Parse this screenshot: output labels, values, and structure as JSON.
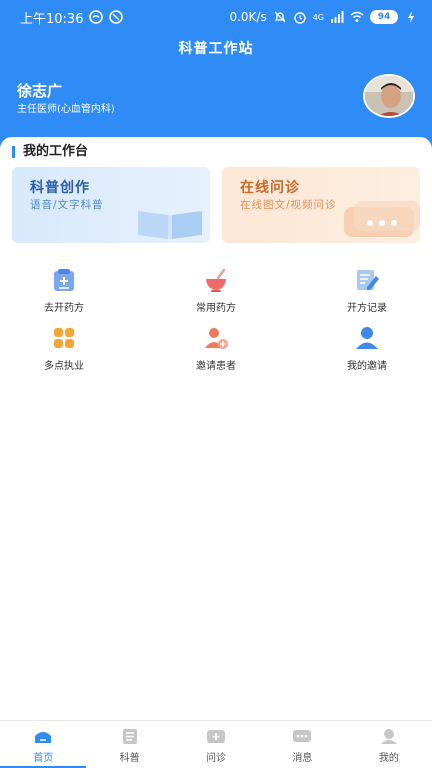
{
  "status_bar": {
    "time": "上午10:36",
    "speed": "0.0K/s",
    "network": "4G",
    "battery": "94"
  },
  "header": {
    "title": "科普工作站",
    "doctor_name": "徐志广",
    "doctor_title": "主任医师(心血管内科)"
  },
  "workbench": {
    "title": "我的工作台",
    "cards": [
      {
        "title": "科普创作",
        "subtitle": "语音/文字科普"
      },
      {
        "title": "在线问诊",
        "subtitle": "在线图文/视频问诊"
      }
    ],
    "grid": [
      {
        "label": "去开药方",
        "icon": "prescription-icon"
      },
      {
        "label": "常用药方",
        "icon": "medicine-bowl-icon"
      },
      {
        "label": "开方记录",
        "icon": "record-edit-icon"
      },
      {
        "label": "多点执业",
        "icon": "multi-grid-icon"
      },
      {
        "label": "邀请患者",
        "icon": "invite-patient-icon"
      },
      {
        "label": "我的邀请",
        "icon": "my-invite-icon"
      }
    ]
  },
  "tabbar": {
    "tabs": [
      {
        "label": "首页",
        "icon": "home-icon",
        "active": true
      },
      {
        "label": "科普",
        "icon": "article-icon"
      },
      {
        "label": "问诊",
        "icon": "consult-icon"
      },
      {
        "label": "消息",
        "icon": "message-icon"
      },
      {
        "label": "我的",
        "icon": "profile-icon"
      }
    ]
  },
  "colors": {
    "primary": "#2f8bf5",
    "card_blue": "#d8e9fd",
    "card_orange": "#fde7d6"
  }
}
